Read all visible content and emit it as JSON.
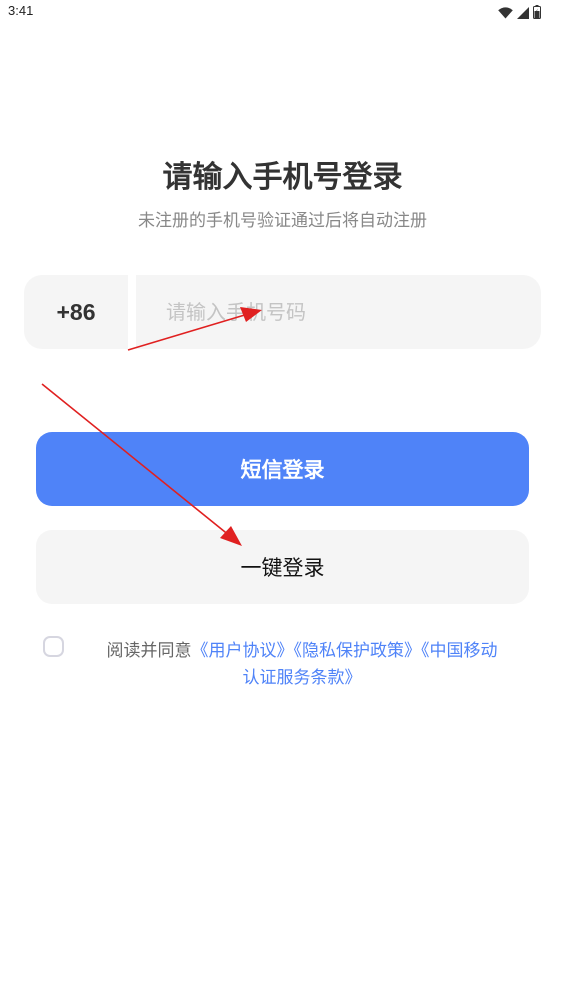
{
  "status_bar": {
    "time": "3:41"
  },
  "header": {
    "title": "请输入手机号登录",
    "subtitle": "未注册的手机号验证通过后将自动注册"
  },
  "phone": {
    "country_code": "+86",
    "placeholder": "请输入手机号码",
    "value": ""
  },
  "buttons": {
    "sms_login": "短信登录",
    "one_click_login": "一键登录"
  },
  "agreement": {
    "prefix": "阅读并同意",
    "user_agreement": "《用户协议》",
    "privacy_policy": "《隐私保护政策》",
    "cmcc_terms_line1": "《中国移动",
    "cmcc_terms_line2": "认证服务条款》",
    "checked": false
  },
  "colors": {
    "primary": "#4f83f8",
    "input_bg": "#f5f5f5",
    "annotation_arrow": "#e02020"
  },
  "icons": [
    "wifi-icon",
    "signal-icon",
    "battery-icon"
  ]
}
